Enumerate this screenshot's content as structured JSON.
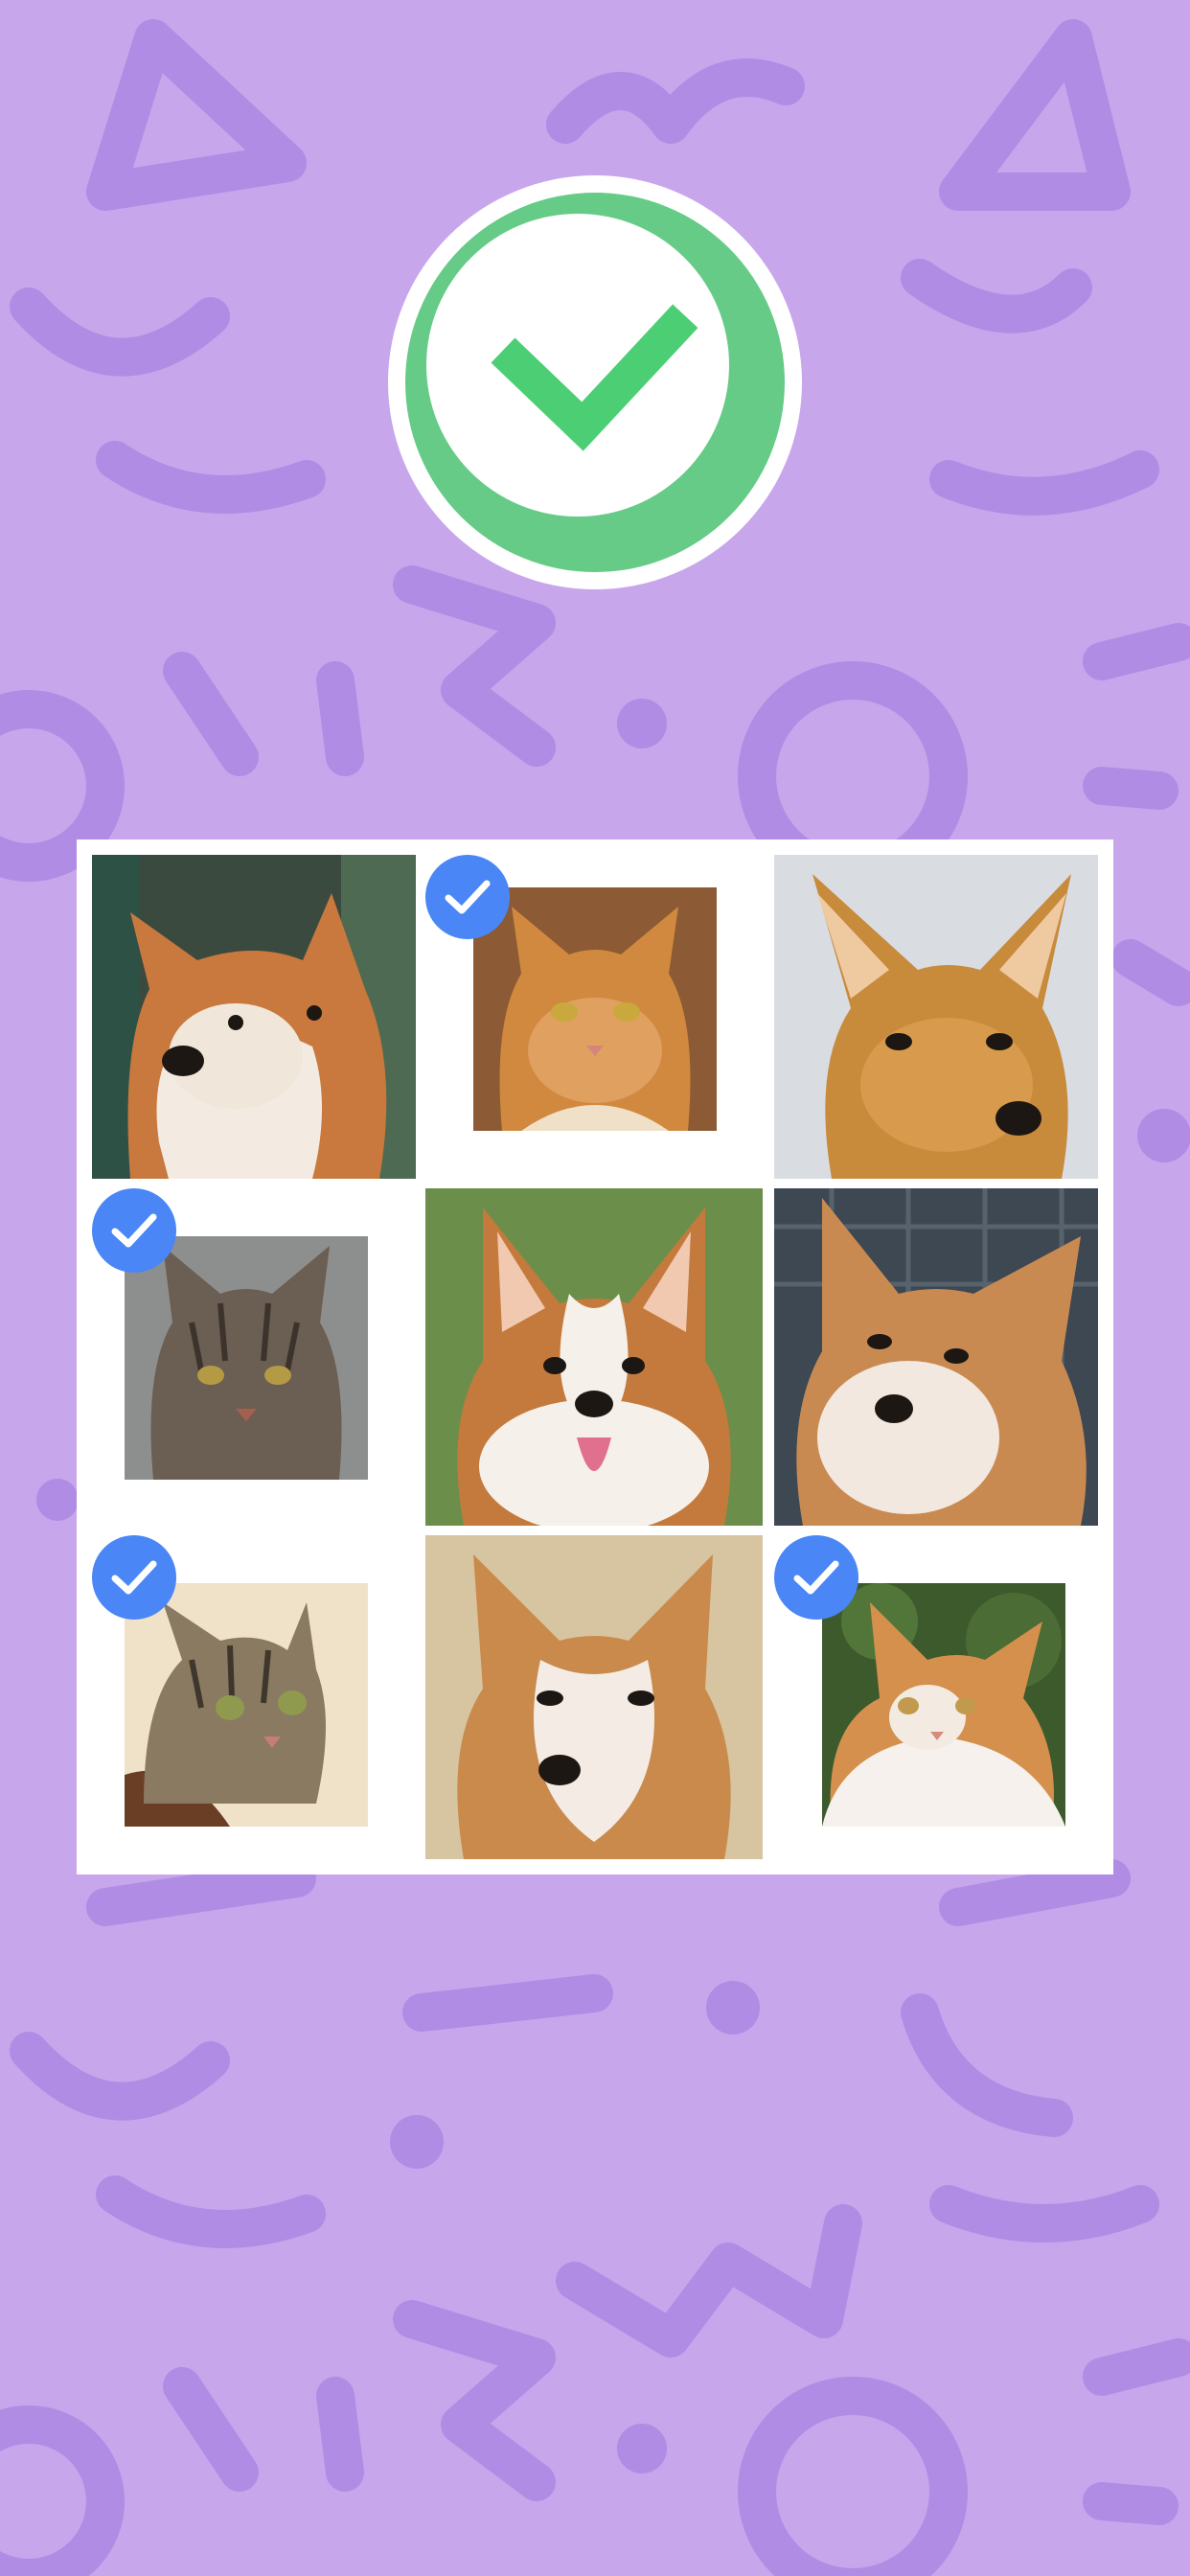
{
  "screen": {
    "background_color": "#c8a6ec",
    "pattern_color": "#b08ce4"
  },
  "success_badge": {
    "icon": "checkmark-icon",
    "ring_color": "#65cb86",
    "check_color": "#4ccf74"
  },
  "captcha_grid": {
    "selection_color": "#4a86f5",
    "tiles": [
      {
        "subject": "shiba-inu-dog",
        "selected": false
      },
      {
        "subject": "orange-cat",
        "selected": true
      },
      {
        "subject": "chihuahua-dog",
        "selected": false
      },
      {
        "subject": "tabby-cat",
        "selected": true
      },
      {
        "subject": "corgi-dog",
        "selected": false
      },
      {
        "subject": "shiba-inu-dog",
        "selected": false
      },
      {
        "subject": "tabby-kitten",
        "selected": true
      },
      {
        "subject": "shiba-inu-dog",
        "selected": false
      },
      {
        "subject": "orange-white-cat",
        "selected": true
      }
    ]
  }
}
